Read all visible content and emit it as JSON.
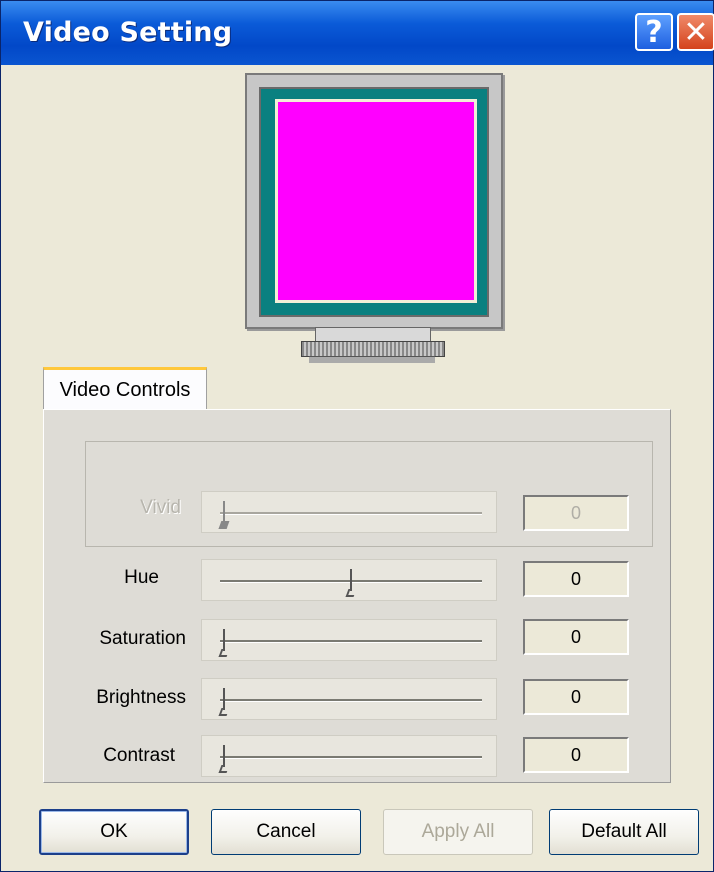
{
  "window": {
    "title": "Video Setting",
    "help_glyph": "?",
    "close_glyph": "✕"
  },
  "colors": {
    "preview_screen": "#ff00ff",
    "bezel": "#0a8080",
    "title_bar": "#0b5bd8"
  },
  "tab": {
    "label": "Video Controls"
  },
  "controls": [
    {
      "label": "Vivid",
      "value": "0",
      "level": 0,
      "enabled": false
    },
    {
      "label": "Hue",
      "value": "0",
      "level": 0.5,
      "enabled": true
    },
    {
      "label": "Saturation",
      "value": "0",
      "level": 0,
      "enabled": true
    },
    {
      "label": "Brightness",
      "value": "0",
      "level": 0,
      "enabled": true
    },
    {
      "label": "Contrast",
      "value": "0",
      "level": 0,
      "enabled": true
    }
  ],
  "buttons": {
    "ok": "OK",
    "cancel": "Cancel",
    "apply_all": "Apply All",
    "default_all": "Default All"
  }
}
